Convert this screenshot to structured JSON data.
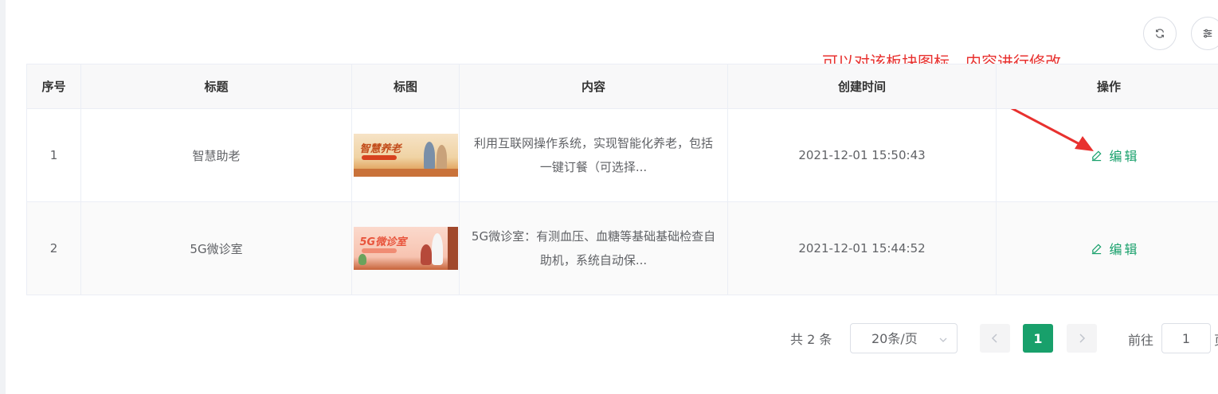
{
  "annotation": "可以对该板块图标、内容进行修改",
  "table": {
    "headers": [
      "序号",
      "标题",
      "标图",
      "内容",
      "创建时间",
      "操作"
    ],
    "rows": [
      {
        "index": "1",
        "title": "智慧助老",
        "image_text": "智慧养老",
        "content": "利用互联网操作系统，实现智能化养老，包括一键订餐（可选择...",
        "created": "2021-12-01 15:50:43",
        "action": "编辑"
      },
      {
        "index": "2",
        "title": "5G微诊室",
        "image_text": "5G微诊室",
        "content": "5G微诊室：有测血压、血糖等基础基础检查自助机，系统自动保...",
        "created": "2021-12-01 15:44:52",
        "action": "编辑"
      }
    ]
  },
  "pagination": {
    "total": "共 2 条",
    "page_size": "20条/页",
    "current_page": "1",
    "goto_label": "前往",
    "goto_value": "1",
    "goto_suffix": "页"
  },
  "colors": {
    "accent": "#18a06b",
    "annotation": "#e8312f",
    "header_bg": "#f8f8f9",
    "border": "#ebeef5"
  },
  "icons": {
    "refresh": "refresh-icon",
    "columns": "column-settings-icon",
    "edit": "edit-icon"
  }
}
